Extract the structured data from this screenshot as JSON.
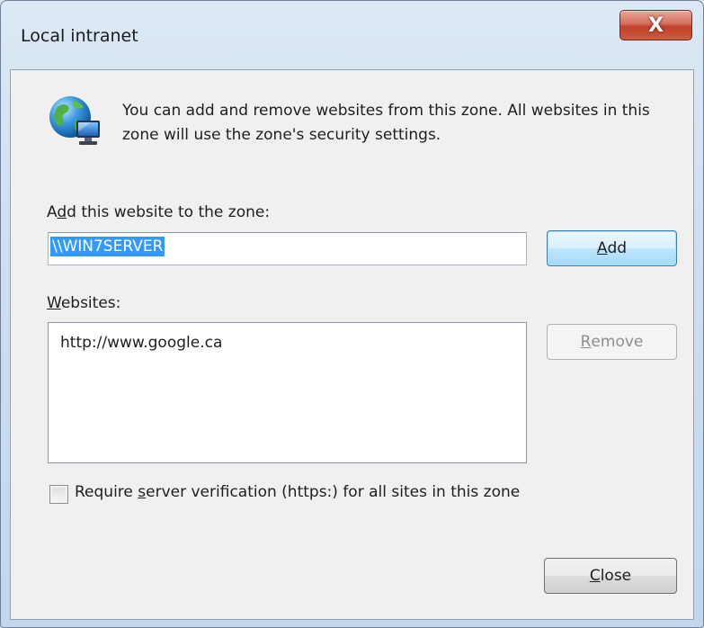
{
  "window": {
    "title": "Local intranet",
    "close_glyph": "X"
  },
  "intro": {
    "icon": "globe-computer-icon",
    "text": "You can add and remove websites from this zone. All websites in this zone will use the zone's security settings."
  },
  "add_site": {
    "label_pre": "A",
    "label_mnemonic": "d",
    "label_post": "d this website to the zone:",
    "value": "\\\\WIN7SERVER",
    "button_mnemonic": "A",
    "button_rest": "dd"
  },
  "websites": {
    "label_mnemonic": "W",
    "label_rest": "ebsites:",
    "items": [
      "http://www.google.ca"
    ],
    "remove_mnemonic": "R",
    "remove_rest": "emove",
    "remove_enabled": false
  },
  "verification": {
    "label_pre": "Require ",
    "label_mnemonic": "s",
    "label_post": "erver verification (https:) for all sites in this zone",
    "checked": false
  },
  "footer": {
    "close_mnemonic": "C",
    "close_rest": "lose"
  }
}
